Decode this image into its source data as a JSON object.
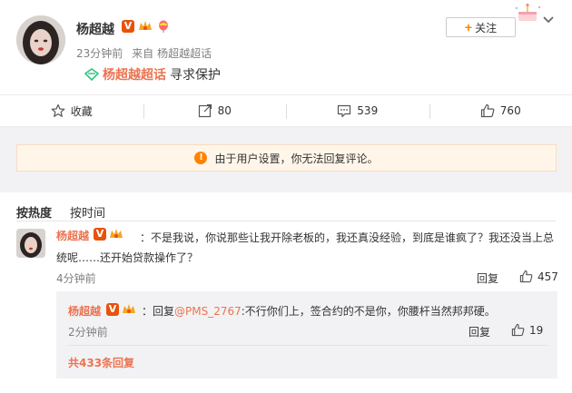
{
  "post": {
    "author": "杨超越",
    "badge_v": "V",
    "time": "23分钟前",
    "source_prefix": "来自",
    "source": "杨超越超话",
    "topic_link": "杨超越超话",
    "topic_text": "寻求保护",
    "follow_plus": "+",
    "follow_label": "关注"
  },
  "actions": {
    "favorite": "收藏",
    "repost": "80",
    "comment": "539",
    "like": "760"
  },
  "notice": {
    "icon": "!",
    "text": "由于用户设置，你无法回复评论。"
  },
  "sort": {
    "hot": "按热度",
    "time": "按时间"
  },
  "comment": {
    "name": "杨超越",
    "badge_v": "V",
    "text": "：不是我说，你说那些让我开除老板的，我还真没经验，到底是谁疯了？我还没当上总统呢……还开始贷款操作了？",
    "time": "4分钟前",
    "reply_label": "回复",
    "likes": "457"
  },
  "reply": {
    "name": "杨超越",
    "badge_v": "V",
    "prefix": "：回复",
    "mention": "@PMS_2767",
    "text": ":不行你们上，签合约的不是你，你腰杆当然邦邦硬。",
    "time": "2分钟前",
    "reply_label": "回复",
    "likes": "19",
    "more": "共433条回复"
  },
  "colors": {
    "accent": "#eb7350",
    "verified": "#e8520a",
    "topic_icon": "#2ec27e",
    "follow_plus": "#ff8200",
    "notice_bg": "#fff6e9",
    "gray_bg": "#f2f2f5"
  },
  "icons": [
    "star-icon",
    "repost-icon",
    "comment-icon",
    "thumbs-up-icon",
    "chevron-down-icon",
    "crown-badge-icon",
    "balloon-badge-icon",
    "topic-diamond-icon",
    "warning-icon"
  ]
}
